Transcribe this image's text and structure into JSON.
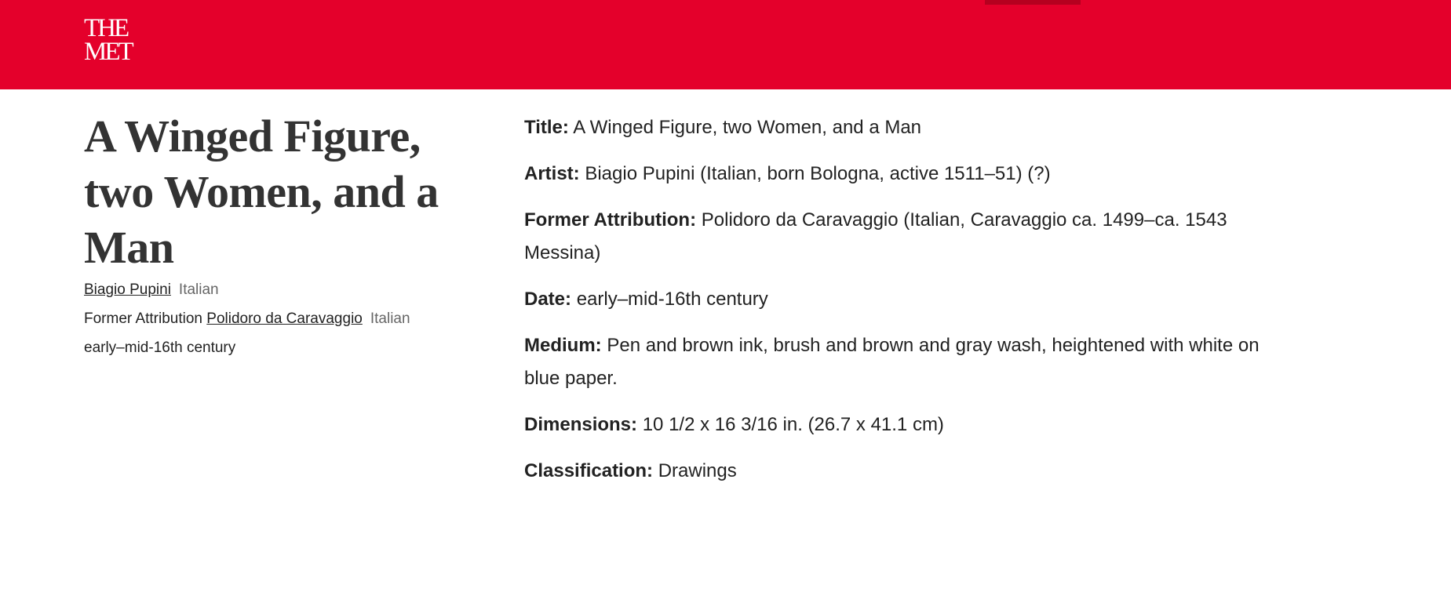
{
  "header": {
    "logo_line1": "THE",
    "logo_line2": "MET",
    "background_color": "#e4002b"
  },
  "artwork": {
    "title": "A Winged Figure, two Women, and a Man",
    "artist_name": "Biagio Pupini",
    "artist_nationality": "Italian",
    "former_attribution_label": "Former Attribution",
    "former_attribution_name": "Polidoro da Caravaggio",
    "former_attribution_nationality": "Italian",
    "date": "early–mid-16th century"
  },
  "details": [
    {
      "label": "Title:",
      "value": "A Winged Figure, two Women, and a Man"
    },
    {
      "label": "Artist:",
      "value": "Biagio Pupini (Italian, born Bologna, active 1511–51) (?)"
    },
    {
      "label": "Former Attribution:",
      "value": "Polidoro da Caravaggio (Italian, Caravaggio ca. 1499–ca. 1543 Messina)"
    },
    {
      "label": "Date:",
      "value": "early–mid-16th century"
    },
    {
      "label": "Medium:",
      "value": "Pen and brown ink, brush and brown and gray wash, heightened with white on blue paper."
    },
    {
      "label": "Dimensions:",
      "value": "10 1/2 x 16 3/16 in. (26.7 x 41.1 cm)"
    },
    {
      "label": "Classification:",
      "value": "Drawings"
    }
  ]
}
